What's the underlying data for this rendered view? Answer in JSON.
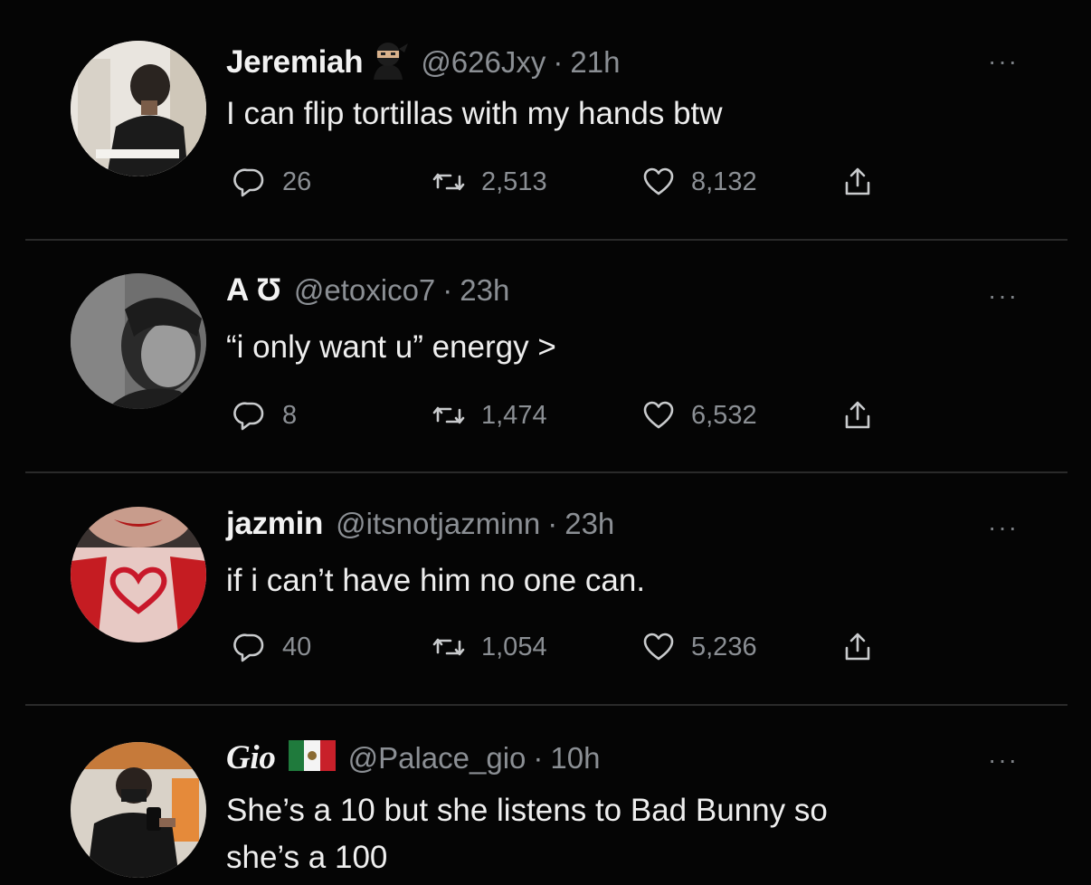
{
  "tweets": [
    {
      "name": "Jeremiah",
      "name_emoji": "ninja-emoji",
      "handle": "@626Jxy",
      "separator": "·",
      "time": "21h",
      "text": "I can flip tortillas with my hands btw",
      "replies": "26",
      "retweets": "2,513",
      "likes": "8,132",
      "more": "···"
    },
    {
      "name": "A Ʊ",
      "handle": "@etoxico7",
      "separator": "·",
      "time": "23h",
      "text": "“i only want u” energy >",
      "replies": "8",
      "retweets": "1,474",
      "likes": "6,532",
      "more": "···"
    },
    {
      "name": "jazmin",
      "handle": "@itsnotjazminn",
      "separator": "·",
      "time": "23h",
      "text": "if i can’t have him no one can.",
      "replies": "40",
      "retweets": "1,054",
      "likes": "5,236",
      "more": "···"
    },
    {
      "name": "Gio",
      "name_emoji": "mexico-flag-emoji",
      "handle": "@Palace_gio",
      "separator": "·",
      "time": "10h",
      "text_line1": "She’s a 10 but she listens to Bad Bunny so",
      "text_line2": "she’s a 100",
      "more": "···"
    }
  ],
  "icons": [
    "reply-icon",
    "retweet-icon",
    "like-icon",
    "share-icon"
  ],
  "colors": {
    "background": "#050505",
    "muted": "#8b8f94",
    "text": "#eeeeee",
    "divider": "#2a2a2a"
  }
}
